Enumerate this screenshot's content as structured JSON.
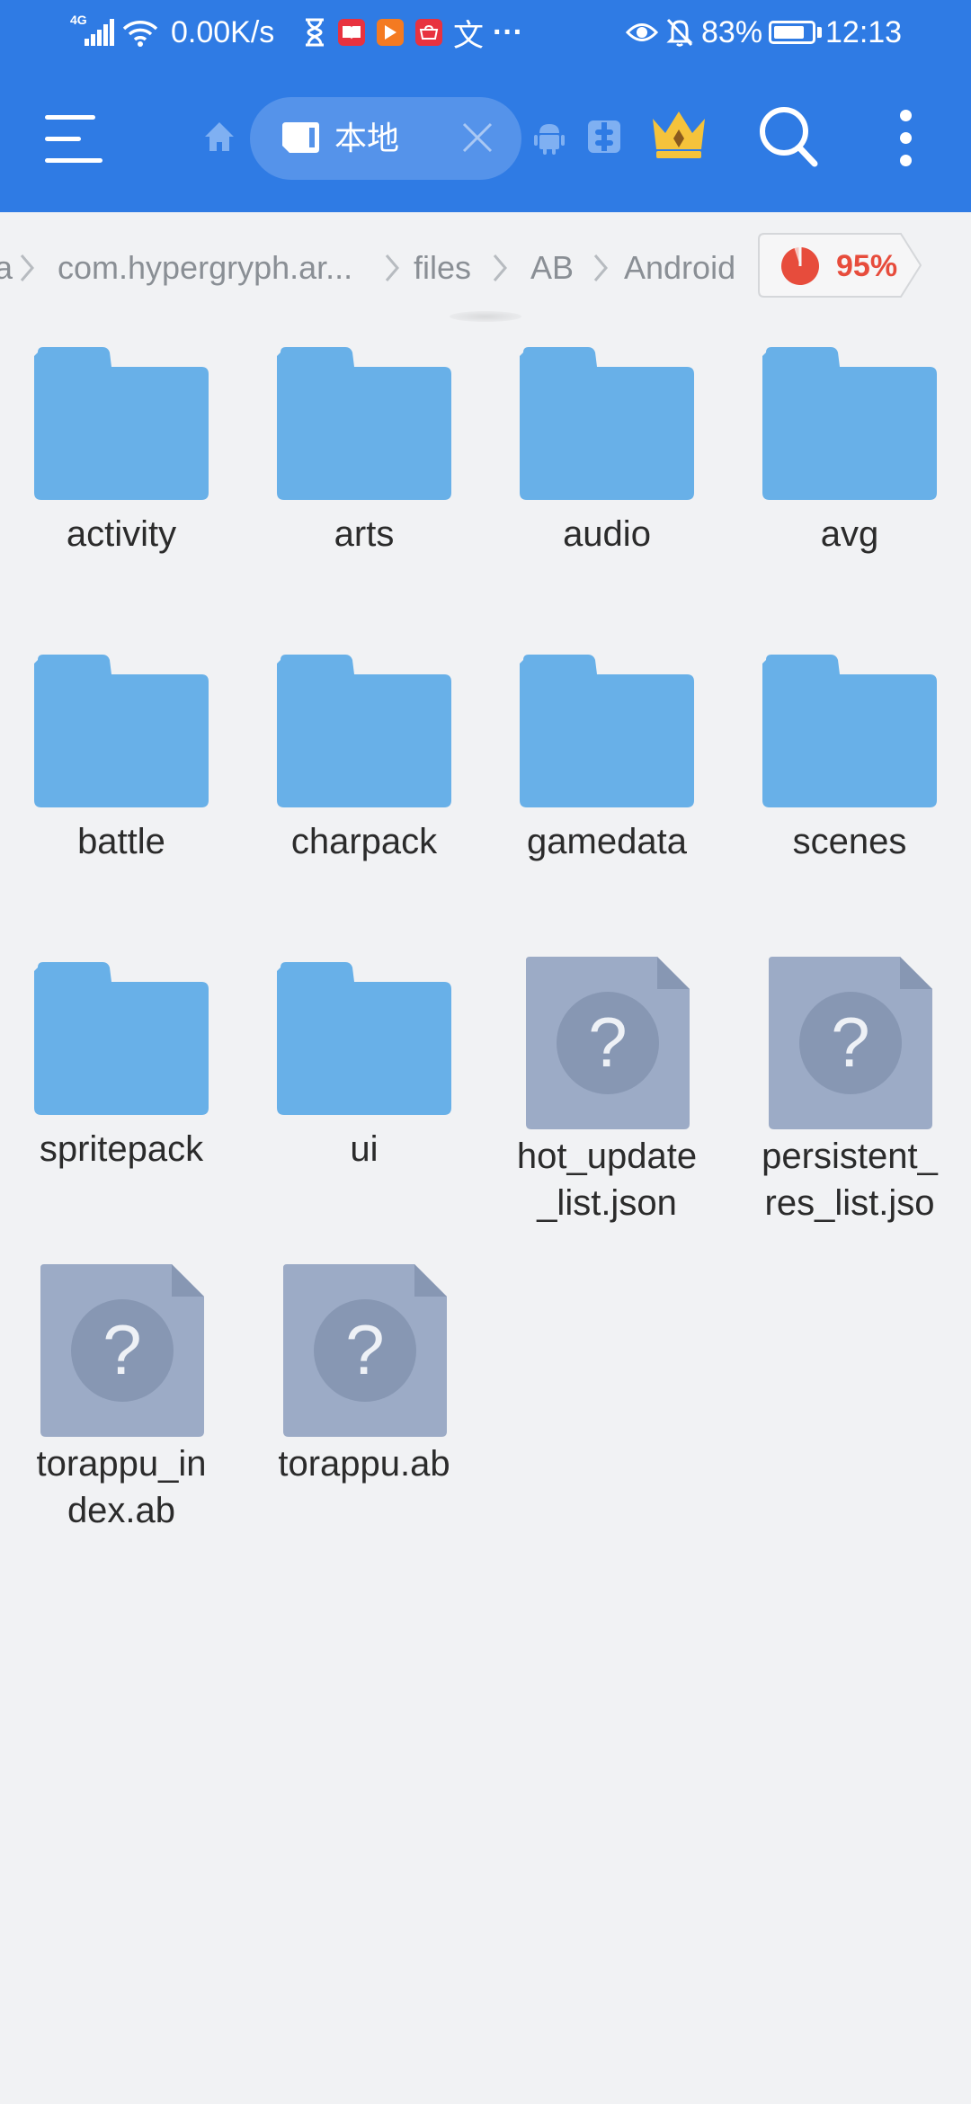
{
  "status_bar": {
    "network": "4G",
    "speed": "0.00K/s",
    "battery_percent_text": "83%",
    "battery_level": 0.83,
    "time": "12:13",
    "app_icons": [
      "hourglass-icon",
      "reader-app-icon",
      "video-app-icon",
      "huawei-app-icon",
      "translate-icon",
      "more-dots-icon"
    ],
    "translate_glyph": "文",
    "more_glyph": "···"
  },
  "toolbar": {
    "tab_label": "本地",
    "colors": {
      "bar": "#2f7be4",
      "pill": "#5593ea",
      "crown": "#f5c33b"
    }
  },
  "breadcrumb": {
    "items": [
      "a",
      "com.hypergryph.ar...",
      "files",
      "AB",
      "Android"
    ],
    "storage_text": "95%",
    "storage_level": 0.95
  },
  "files": [
    {
      "name": "activity",
      "kind": "folder"
    },
    {
      "name": "arts",
      "kind": "folder"
    },
    {
      "name": "audio",
      "kind": "folder"
    },
    {
      "name": "avg",
      "kind": "folder"
    },
    {
      "name": "battle",
      "kind": "folder"
    },
    {
      "name": "charpack",
      "kind": "folder"
    },
    {
      "name": "gamedata",
      "kind": "folder"
    },
    {
      "name": "scenes",
      "kind": "folder"
    },
    {
      "name": "spritepack",
      "kind": "folder"
    },
    {
      "name": "ui",
      "kind": "folder"
    },
    {
      "name": "hot_update_list.json",
      "display": "hot_update\n_list.json",
      "kind": "file"
    },
    {
      "name": "persistent_res_list.jso",
      "display": "persistent_\nres_list.jso",
      "kind": "file"
    },
    {
      "name": "torappu_index.ab",
      "display": "torappu_in\ndex.ab",
      "kind": "file"
    },
    {
      "name": "torappu.ab",
      "kind": "file"
    }
  ],
  "colors": {
    "folder": "#68b0e8",
    "unknown_file": "#9cabc6",
    "unknown_circle": "#8797b3"
  }
}
